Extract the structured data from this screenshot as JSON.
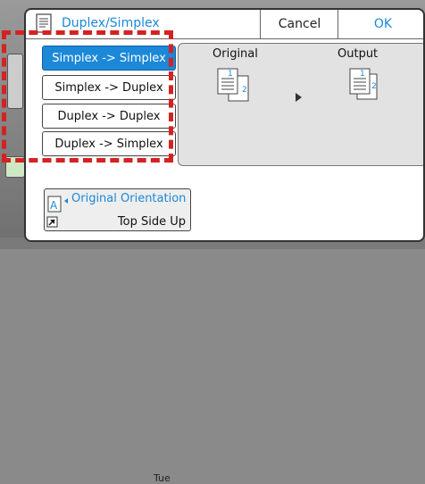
{
  "dialog": {
    "title": "Duplex/Simplex",
    "cancel_label": "Cancel",
    "ok_label": "OK"
  },
  "options": [
    {
      "label": "Simplex -> Simplex",
      "selected": true
    },
    {
      "label": "Simplex -> Duplex",
      "selected": false
    },
    {
      "label": "Duplex -> Duplex",
      "selected": false
    },
    {
      "label": "Duplex -> Simplex",
      "selected": false
    }
  ],
  "preview": {
    "original_label": "Original",
    "output_label": "Output",
    "original_page_numbers": [
      "1",
      "2"
    ],
    "output_page_numbers": [
      "1",
      "2"
    ]
  },
  "orientation": {
    "label": "Original Orientation",
    "value": "Top Side Up",
    "icon_letter": "A"
  },
  "background": {
    "partial_text": "Tue"
  },
  "colors": {
    "accent": "#1c88d8",
    "highlight_box": "#d42222",
    "panel": "#e2e2e2"
  }
}
